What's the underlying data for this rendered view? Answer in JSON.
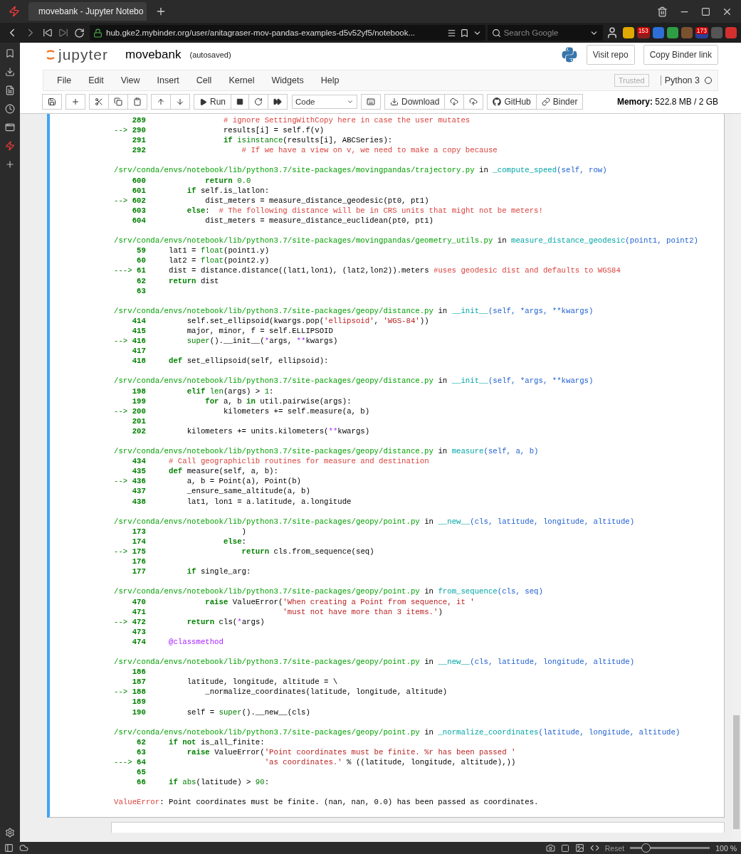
{
  "browser": {
    "tab_title": "movebank - Jupyter Notebo",
    "address": "hub.gke2.mybinder.org/user/anitagraser-mov-pandas-examples-d5v52yf5/notebook...",
    "search_placeholder": "Search Google",
    "badges": [
      "153",
      "173"
    ]
  },
  "jupyter": {
    "logo_text": "jupyter",
    "notebook_name": "movebank",
    "save_status": "(autosaved)",
    "header_buttons": [
      "Visit repo",
      "Copy Binder link"
    ],
    "menu": [
      "File",
      "Edit",
      "View",
      "Insert",
      "Cell",
      "Kernel",
      "Widgets",
      "Help"
    ],
    "trusted": "Trusted",
    "kernel": "Python 3",
    "kernel_busy": false,
    "toolbar": {
      "run": "Run",
      "cell_type": "Code",
      "download": "Download",
      "github": "GitHub",
      "binder": "Binder"
    },
    "memory_label": "Memory:",
    "memory_value": "522.8 MB / 2 GB"
  },
  "traceback": {
    "frames": [
      {
        "lines": [
          {
            "num": "289",
            "code": [
              {
                "t": "                # ignore SettingWithCopy here in case the user mutates",
                "kind": "comment"
              }
            ]
          },
          {
            "num": "290",
            "arrow": "-->",
            "code": [
              {
                "t": "                results[i] = self.f(v)"
              }
            ]
          },
          {
            "num": "291",
            "code": [
              {
                "t": "                if",
                "kind": "keyword"
              },
              {
                "t": " isinstance",
                "kind": "builtin"
              },
              {
                "t": "(results[i], ABCSeries):"
              }
            ]
          },
          {
            "num": "292",
            "code": [
              {
                "t": "                    # If we have a view on v, we need to make a copy because",
                "kind": "comment"
              }
            ]
          }
        ]
      },
      {
        "path": "/srv/conda/envs/notebook/lib/python3.7/site-packages/movingpandas/trajectory.py",
        "in_word": "in",
        "func": "_compute_speed",
        "args": "(self, row)",
        "lines": [
          {
            "num": "600",
            "code": [
              {
                "t": "            return",
                "kind": "keyword"
              },
              {
                "t": " 0.0",
                "kind": "number"
              }
            ]
          },
          {
            "num": "601",
            "code": [
              {
                "t": "        if",
                "kind": "keyword"
              },
              {
                "t": " self.is_latlon:"
              }
            ]
          },
          {
            "num": "602",
            "arrow": "-->",
            "code": [
              {
                "t": "            dist_meters = measure_distance_geodesic(pt0, pt1)"
              }
            ]
          },
          {
            "num": "603",
            "code": [
              {
                "t": "        else",
                "kind": "keyword"
              },
              {
                "t": ":  "
              },
              {
                "t": "# The following distance will be in CRS units that might not be meters!",
                "kind": "comment"
              }
            ]
          },
          {
            "num": "604",
            "code": [
              {
                "t": "            dist_meters = measure_distance_euclidean(pt0, pt1)"
              }
            ]
          }
        ]
      },
      {
        "path": "/srv/conda/envs/notebook/lib/python3.7/site-packages/movingpandas/geometry_utils.py",
        "in_word": "in",
        "func": "measure_distance_geodesic",
        "args": "(point1, point2)",
        "lines": [
          {
            "num": "59",
            "code": [
              {
                "t": "    lat1 = "
              },
              {
                "t": "float",
                "kind": "builtin"
              },
              {
                "t": "(point1.y)"
              }
            ]
          },
          {
            "num": "60",
            "code": [
              {
                "t": "    lat2 = "
              },
              {
                "t": "float",
                "kind": "builtin"
              },
              {
                "t": "(point2.y)"
              }
            ]
          },
          {
            "num": "61",
            "arrow": "--->",
            "code": [
              {
                "t": "    dist = distance.distance((lat1,lon1), (lat2,lon2)).meters "
              },
              {
                "t": "#uses geodesic dist and defaults to WGS84",
                "kind": "comment"
              }
            ]
          },
          {
            "num": "62",
            "code": [
              {
                "t": "    return",
                "kind": "keyword"
              },
              {
                "t": " dist"
              }
            ]
          },
          {
            "num": "63"
          }
        ]
      },
      {
        "path": "/srv/conda/envs/notebook/lib/python3.7/site-packages/geopy/distance.py",
        "in_word": "in",
        "func": "__init__",
        "args": "(self, *args, **kwargs)",
        "lines": [
          {
            "num": "414",
            "code": [
              {
                "t": "        self.set_ellipsoid(kwargs.pop("
              },
              {
                "t": "'ellipsoid'",
                "kind": "string"
              },
              {
                "t": ", "
              },
              {
                "t": "'WGS-84'",
                "kind": "string"
              },
              {
                "t": "))"
              }
            ]
          },
          {
            "num": "415",
            "code": [
              {
                "t": "        major, minor, f = self.ELLIPSOID"
              }
            ]
          },
          {
            "num": "416",
            "arrow": "-->",
            "code": [
              {
                "t": "        super",
                "kind": "builtin"
              },
              {
                "t": "().__init__("
              },
              {
                "t": "*",
                "kind": "operator"
              },
              {
                "t": "args, "
              },
              {
                "t": "**",
                "kind": "operator"
              },
              {
                "t": "kwargs)"
              }
            ]
          },
          {
            "num": "417"
          },
          {
            "num": "418",
            "code": [
              {
                "t": "    def",
                "kind": "keyword"
              },
              {
                "t": " set_ellipsoid(self, ellipsoid):"
              }
            ]
          }
        ]
      },
      {
        "path": "/srv/conda/envs/notebook/lib/python3.7/site-packages/geopy/distance.py",
        "in_word": "in",
        "func": "__init__",
        "args": "(self, *args, **kwargs)",
        "lines": [
          {
            "num": "198",
            "code": [
              {
                "t": "        elif",
                "kind": "keyword"
              },
              {
                "t": " len",
                "kind": "builtin"
              },
              {
                "t": "(args) > "
              },
              {
                "t": "1",
                "kind": "number"
              },
              {
                "t": ":"
              }
            ]
          },
          {
            "num": "199",
            "code": [
              {
                "t": "            for",
                "kind": "keyword"
              },
              {
                "t": " a, b "
              },
              {
                "t": "in",
                "kind": "keyword"
              },
              {
                "t": " util.pairwise(args):"
              }
            ]
          },
          {
            "num": "200",
            "arrow": "-->",
            "code": [
              {
                "t": "                kilometers += self.measure(a, b)"
              }
            ]
          },
          {
            "num": "201"
          },
          {
            "num": "202",
            "code": [
              {
                "t": "        kilometers += units.kilometers("
              },
              {
                "t": "**",
                "kind": "operator"
              },
              {
                "t": "kwargs)"
              }
            ]
          }
        ]
      },
      {
        "path": "/srv/conda/envs/notebook/lib/python3.7/site-packages/geopy/distance.py",
        "in_word": "in",
        "func": "measure",
        "args": "(self, a, b)",
        "lines": [
          {
            "num": "434",
            "code": [
              {
                "t": "    # Call geographiclib routines for measure and destination",
                "kind": "comment"
              }
            ]
          },
          {
            "num": "435",
            "code": [
              {
                "t": "    def",
                "kind": "keyword"
              },
              {
                "t": " measure(self, a, b):"
              }
            ]
          },
          {
            "num": "436",
            "arrow": "-->",
            "code": [
              {
                "t": "        a, b = Point(a), Point(b)"
              }
            ]
          },
          {
            "num": "437",
            "code": [
              {
                "t": "        _ensure_same_altitude(a, b)"
              }
            ]
          },
          {
            "num": "438",
            "code": [
              {
                "t": "        lat1, lon1 = a.latitude, a.longitude"
              }
            ]
          }
        ]
      },
      {
        "path": "/srv/conda/envs/notebook/lib/python3.7/site-packages/geopy/point.py",
        "in_word": "in",
        "func": "__new__",
        "args": "(cls, latitude, longitude, altitude)",
        "lines": [
          {
            "num": "173",
            "code": [
              {
                "t": "                    )"
              }
            ]
          },
          {
            "num": "174",
            "code": [
              {
                "t": "                else",
                "kind": "keyword"
              },
              {
                "t": ":"
              }
            ]
          },
          {
            "num": "175",
            "arrow": "-->",
            "code": [
              {
                "t": "                    return",
                "kind": "keyword"
              },
              {
                "t": " cls.from_sequence(seq)"
              }
            ]
          },
          {
            "num": "176"
          },
          {
            "num": "177",
            "code": [
              {
                "t": "        if",
                "kind": "keyword"
              },
              {
                "t": " single_arg:"
              }
            ]
          }
        ]
      },
      {
        "path": "/srv/conda/envs/notebook/lib/python3.7/site-packages/geopy/point.py",
        "in_word": "in",
        "func": "from_sequence",
        "args": "(cls, seq)",
        "lines": [
          {
            "num": "470",
            "code": [
              {
                "t": "            raise",
                "kind": "keyword"
              },
              {
                "t": " ValueError("
              },
              {
                "t": "'When creating a Point from sequence, it '",
                "kind": "string"
              }
            ]
          },
          {
            "num": "471",
            "code": [
              {
                "t": "                             'must not have more than 3 items.'",
                "kind": "string"
              },
              {
                "t": ")"
              }
            ]
          },
          {
            "num": "472",
            "arrow": "-->",
            "code": [
              {
                "t": "        return",
                "kind": "keyword"
              },
              {
                "t": " cls("
              },
              {
                "t": "*",
                "kind": "operator"
              },
              {
                "t": "args)"
              }
            ]
          },
          {
            "num": "473"
          },
          {
            "num": "474",
            "code": [
              {
                "t": "    @classmethod",
                "kind": "decorator"
              }
            ]
          }
        ]
      },
      {
        "path": "/srv/conda/envs/notebook/lib/python3.7/site-packages/geopy/point.py",
        "in_word": "in",
        "func": "__new__",
        "args": "(cls, latitude, longitude, altitude)",
        "lines": [
          {
            "num": "186"
          },
          {
            "num": "187",
            "code": [
              {
                "t": "        latitude, longitude, altitude = \\"
              }
            ]
          },
          {
            "num": "188",
            "arrow": "-->",
            "code": [
              {
                "t": "            _normalize_coordinates(latitude, longitude, altitude)"
              }
            ]
          },
          {
            "num": "189"
          },
          {
            "num": "190",
            "code": [
              {
                "t": "        self = "
              },
              {
                "t": "super",
                "kind": "builtin"
              },
              {
                "t": "().__new__(cls)"
              }
            ]
          }
        ]
      },
      {
        "path": "/srv/conda/envs/notebook/lib/python3.7/site-packages/geopy/point.py",
        "in_word": "in",
        "func": "_normalize_coordinates",
        "args": "(latitude, longitude, altitude)",
        "lines": [
          {
            "num": "62",
            "code": [
              {
                "t": "    if not",
                "kind": "keyword"
              },
              {
                "t": " is_all_finite:"
              }
            ]
          },
          {
            "num": "63",
            "code": [
              {
                "t": "        raise",
                "kind": "keyword"
              },
              {
                "t": " ValueError("
              },
              {
                "t": "'Point coordinates must be finite. %r has been passed '",
                "kind": "string"
              }
            ]
          },
          {
            "num": "64",
            "arrow": "--->",
            "code": [
              {
                "t": "                         'as coordinates.'",
                "kind": "string"
              },
              {
                "t": " % ((latitude, longitude, altitude),))"
              }
            ]
          },
          {
            "num": "65"
          },
          {
            "num": "66",
            "code": [
              {
                "t": "    if",
                "kind": "keyword"
              },
              {
                "t": " abs",
                "kind": "builtin"
              },
              {
                "t": "(latitude) > "
              },
              {
                "t": "90",
                "kind": "number"
              },
              {
                "t": ":"
              }
            ]
          }
        ]
      }
    ],
    "error_type": "ValueError",
    "error_message": ": Point coordinates must be finite. (nan, nan, 0.0) has been passed as coordinates."
  },
  "status_bar": {
    "reset": "Reset",
    "zoom": "100 %",
    "zoom_slider": {
      "level": 0.2
    }
  }
}
